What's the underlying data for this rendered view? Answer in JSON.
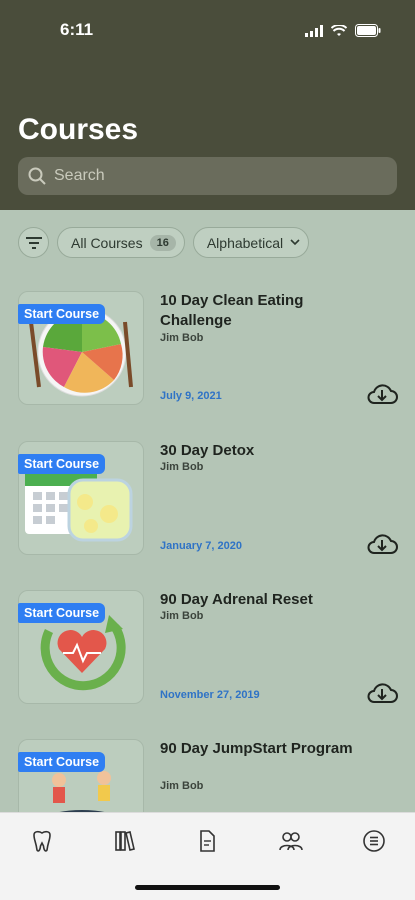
{
  "status_bar": {
    "time": "6:11"
  },
  "header": {
    "title": "Courses"
  },
  "search": {
    "placeholder": "Search"
  },
  "filters": {
    "category_label": "All Courses",
    "category_count": "16",
    "sort_label": "Alphabetical"
  },
  "courses": [
    {
      "title": "10 Day Clean Eating Challenge",
      "author": "Jim Bob",
      "date": "July 9, 2021",
      "badge": "Start Course"
    },
    {
      "title": "30 Day Detox",
      "author": "Jim Bob",
      "date": "January 7, 2020",
      "badge": "Start Course"
    },
    {
      "title": "90 Day Adrenal Reset",
      "author": "Jim Bob",
      "date": "November 27, 2019",
      "badge": "Start Course"
    },
    {
      "title": "90 Day JumpStart Program",
      "author": "Jim Bob",
      "date": "",
      "badge": "Start Course"
    }
  ],
  "tab_bar": {
    "items": [
      "tooth-icon",
      "library-icon",
      "document-icon",
      "people-icon",
      "menu-list-icon"
    ]
  }
}
